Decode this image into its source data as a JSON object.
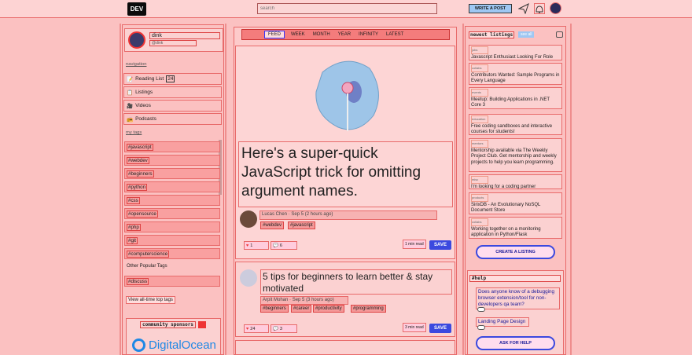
{
  "topbar": {
    "logo": "DEV",
    "search_placeholder": "search",
    "write_label": "WRITE A POST"
  },
  "profile": {
    "name": "dink",
    "handle": "@dink"
  },
  "left": {
    "navigation_label": "navigation",
    "nav": [
      {
        "label": "Reading List",
        "count": "24",
        "icon": "bookmark-icon"
      },
      {
        "label": "Listings",
        "icon": "list-icon"
      },
      {
        "label": "Videos",
        "icon": "video-icon"
      },
      {
        "label": "Podcasts",
        "icon": "podcast-icon"
      }
    ],
    "mytags_label": "my tags",
    "tags": [
      "#javascript",
      "#webdev",
      "#beginners",
      "#python",
      "#css",
      "#opensource",
      "#php",
      "#git",
      "#computerscience"
    ],
    "other_label": "Other Popular Tags",
    "other_tags": [
      "#discuss"
    ],
    "all_tags": "View all-time top tags",
    "sponsors_label": "community sponsors",
    "sponsor_name": "DigitalOcean"
  },
  "feed": {
    "tabs": [
      "FEED",
      "WEEK",
      "MONTH",
      "YEAR",
      "INFINITY",
      "LATEST"
    ],
    "posts": [
      {
        "title": "Here's a super-quick JavaScript trick for omitting argument names.",
        "author": "Lucas Chen",
        "date": "Sep 5",
        "ago": "(2 hours ago)",
        "tags": [
          "#webdev",
          "#javascript"
        ],
        "likes": "1",
        "comments": "6",
        "read": "1 min read",
        "save": "SAVE"
      },
      {
        "title": "5 tips for beginners to learn better & stay motivated",
        "author": "Arpit Mohan",
        "date": "Sep 5",
        "ago": "(3 hours ago)",
        "tags": [
          "#beginners",
          "#career",
          "#productivity",
          "#programming"
        ],
        "likes": "24",
        "comments": "3",
        "read": "3 min read",
        "save": "SAVE"
      }
    ]
  },
  "right": {
    "listings_label": "newest listings",
    "see_all": "see all",
    "listings": [
      {
        "cat": "jobs",
        "title": "Javascript Enthusiast Looking For Role"
      },
      {
        "cat": "collabs",
        "title": "Contributors Wanted: Sample Programs in Every Language"
      },
      {
        "cat": "events",
        "title": "Meetup: Building Applications in .NET Core 3"
      },
      {
        "cat": "education",
        "title": "Free coding sandboxes and interactive courses for students!"
      },
      {
        "cat": "mentors",
        "title": "Mentorship available via The Weekly Project Club. Get mentorship and weekly projects to help you learn programming."
      },
      {
        "cat": "misc",
        "title": "I'm looking for a coding partner"
      },
      {
        "cat": "products",
        "title": "SirixDB - An Evolutionary NoSQL Document Store"
      },
      {
        "cat": "collabs",
        "title": "Working together on a monitoring application in Python/Flask"
      }
    ],
    "create_listing": "CREATE A LISTING",
    "help_label": "#help",
    "help_items": [
      "Does anyone know of a debugging browser extension/tool for non-developers qa team?",
      "Landing Page Design"
    ],
    "ask_help": "ASK FOR HELP"
  },
  "colors": {
    "accent": "#3b49df",
    "bg": "#fbc1c1",
    "outline": "#e86a6a"
  }
}
